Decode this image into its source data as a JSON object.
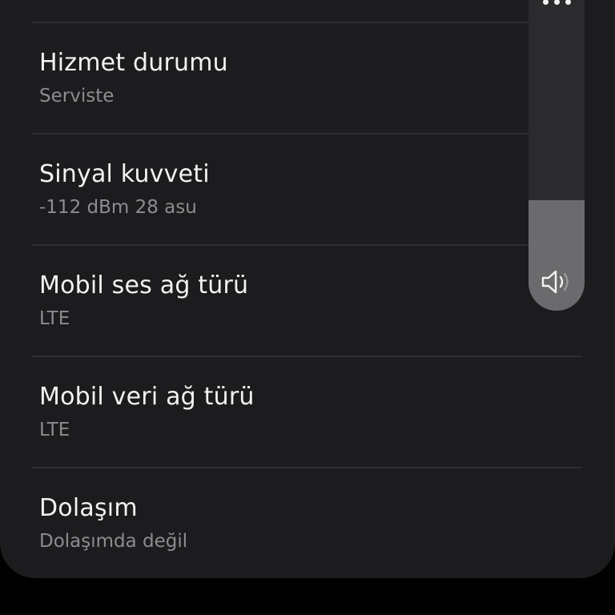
{
  "settings_list": [
    {
      "title": "Hizmet durumu",
      "subtitle": "Serviste"
    },
    {
      "title": "Sinyal kuvveti",
      "subtitle": "-112 dBm 28 asu"
    },
    {
      "title": "Mobil ses ağ türü",
      "subtitle": "LTE"
    },
    {
      "title": "Mobil veri ağ türü",
      "subtitle": "LTE"
    },
    {
      "title": "Dolaşım",
      "subtitle": "Dolaşımda değil"
    }
  ],
  "volume_panel": {
    "level_percent": 33,
    "icons": {
      "more": "more-dots-icon",
      "speaker": "speaker-icon"
    }
  },
  "colors": {
    "background": "#000000",
    "panel": "#1c1c1e",
    "title_text": "#f2f2f2",
    "subtitle_text": "#8d8d90",
    "divider": "#2e2e30",
    "volume_track": "#2b2b2d",
    "volume_fill": "#6b6b6e"
  }
}
